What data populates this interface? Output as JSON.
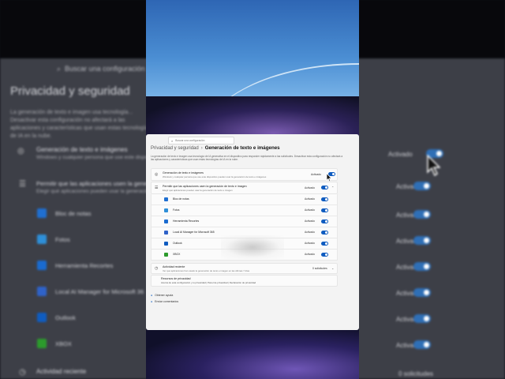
{
  "background": {
    "search_placeholder": "Buscar una configuración",
    "title": "Privacidad y seguridad",
    "description": "La generación de texto e imagen usa tecnología... Desactivar esta configuración no afectará a las aplicaciones y características que usan estas tecnologías de IA en la nube.",
    "row1_title": "Generación de texto e imágenes",
    "row1_sub": "Windows y cualquier persona que use este dispositivo...",
    "row2_title": "Permitir que las aplicaciones usen la gene...",
    "row2_sub": "Elegir qué aplicaciones pueden usar la generación...",
    "apps": [
      "Bloc de notas",
      "Fotos",
      "Herramienta Recortes",
      "Local AI Manager for Microsoft 36",
      "Outlook",
      "XBOX"
    ],
    "state": "Activado",
    "activity": "Actividad reciente",
    "count": "0 solicitudes"
  },
  "window": {
    "search_placeholder": "Buscar una configuración",
    "breadcrumb_parent": "Privacidad y seguridad",
    "breadcrumb_current": "Generación de texto e imágenes",
    "description": "La generación de texto e imagen usa tecnología de IA generativa en el dispositivo para responder rápidamente a las solicitudes. Desactivar esta configuración no afectará a las aplicaciones y características que usan estas tecnologías de IA en la nube.",
    "main_title": "Generación de texto e imágenes",
    "main_sub": "Windows y cualquier persona que use este dispositivo pueden usar la generación de texto e imágenes",
    "main_state": "Activado",
    "apps_title": "Permitir que las aplicaciones usen la generación de texto e imagen",
    "apps_sub": "Elegir qué aplicaciones pueden usar la generación de texto e imagen",
    "apps_state": "Activado",
    "apps": [
      {
        "name": "Bloc de notas",
        "state": "Activado",
        "color": "#1f6fd1"
      },
      {
        "name": "Fotos",
        "state": "Activado",
        "color": "#2e8fd8"
      },
      {
        "name": "Herramienta Recortes",
        "state": "Activado",
        "color": "#1a6bd0"
      },
      {
        "name": "Local AI Manager for Microsoft 365",
        "state": "Activado",
        "color": "#2f62c8"
      },
      {
        "name": "Outlook",
        "state": "Activado",
        "color": "#0f5cc0"
      },
      {
        "name": "XBOX",
        "state": "Activado",
        "color": "#2c9b2c"
      }
    ],
    "activity_title": "Actividad reciente",
    "activity_sub": "Ver qué aplicaciones han usado la generación de texto e imagen en las últimas 7 días",
    "activity_count": "0 solicitudes",
    "resources_title": "Recursos de privacidad",
    "resources_sub": "Acerca de esta configuración y tu privacidad | Panel de privacidad | Declaración de privacidad",
    "help_link": "Obtener ayuda",
    "feedback_link": "Enviar comentarios"
  },
  "colors": {
    "accent": "#0f5cc0",
    "window_bg": "#f3f3f3"
  }
}
